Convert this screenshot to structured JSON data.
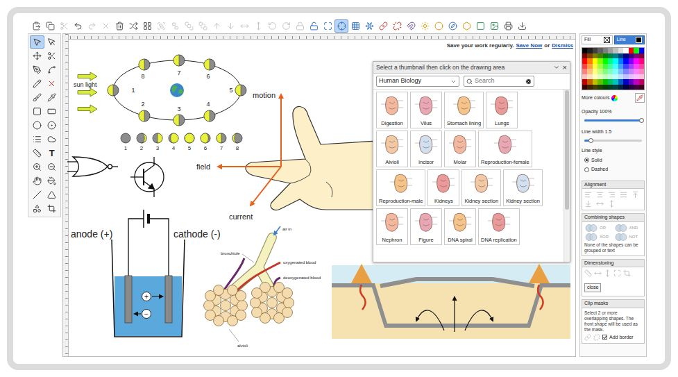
{
  "toolbar": {
    "buttons": [
      {
        "disabled": false,
        "selected": false
      },
      {
        "disabled": false,
        "selected": false
      },
      {
        "disabled": true,
        "selected": false
      },
      {
        "disabled": false,
        "selected": false
      },
      {
        "disabled": true,
        "selected": false
      },
      {
        "disabled": true,
        "selected": false
      },
      {
        "disabled": false,
        "selected": false
      },
      {
        "disabled": false,
        "selected": false
      },
      {
        "disabled": false,
        "selected": false
      },
      {
        "disabled": true,
        "selected": false
      },
      {
        "disabled": true,
        "selected": false
      },
      {
        "disabled": true,
        "selected": false
      },
      {
        "disabled": true,
        "selected": false
      },
      {
        "disabled": true,
        "selected": false
      },
      {
        "disabled": true,
        "selected": false
      },
      {
        "disabled": true,
        "selected": false
      },
      {
        "disabled": true,
        "selected": false
      },
      {
        "disabled": true,
        "selected": false
      },
      {
        "disabled": true,
        "selected": false
      },
      {
        "disabled": true,
        "selected": false
      },
      {
        "disabled": false,
        "selected": false
      },
      {
        "disabled": false,
        "selected": false
      },
      {
        "disabled": false,
        "selected": true
      },
      {
        "disabled": false,
        "selected": false
      },
      {
        "disabled": false,
        "selected": false
      },
      {
        "disabled": false,
        "selected": false
      },
      {
        "disabled": false,
        "selected": false
      },
      {
        "disabled": false,
        "selected": false
      },
      {
        "disabled": false,
        "selected": false
      },
      {
        "disabled": false,
        "selected": false
      },
      {
        "disabled": false,
        "selected": false
      },
      {
        "disabled": false,
        "selected": false
      },
      {
        "disabled": false,
        "selected": false
      },
      {
        "disabled": false,
        "selected": false
      },
      {
        "disabled": false,
        "selected": false
      },
      {
        "disabled": false,
        "selected": false
      }
    ]
  },
  "notice": {
    "text": "Save your work regularly.",
    "save_link": "Save Now",
    "separator": "or",
    "dismiss_link": "Dismiss"
  },
  "tools": [
    {
      "kind": "icon",
      "selected": true
    },
    {
      "kind": "icon",
      "selected": false
    },
    {
      "kind": "icon",
      "selected": false
    },
    {
      "kind": "icon",
      "selected": false
    },
    {
      "kind": "icon",
      "selected": false
    },
    {
      "kind": "icon",
      "selected": false
    },
    {
      "kind": "icon",
      "selected": false
    },
    {
      "kind": "icon",
      "selected": false
    },
    {
      "kind": "icon",
      "selected": false
    },
    {
      "kind": "icon",
      "selected": false
    },
    {
      "kind": "icon",
      "selected": false
    },
    {
      "kind": "icon",
      "selected": false
    },
    {
      "kind": "icon",
      "selected": false
    },
    {
      "kind": "icon",
      "selected": false
    },
    {
      "kind": "icon",
      "selected": false
    },
    {
      "kind": "icon",
      "selected": false
    },
    {
      "kind": "icon",
      "selected": false
    },
    {
      "kind": "glyph",
      "label": "T",
      "selected": false
    },
    {
      "kind": "icon",
      "selected": false
    },
    {
      "kind": "icon",
      "selected": false
    },
    {
      "kind": "icon",
      "selected": false
    },
    {
      "kind": "icon",
      "selected": false
    },
    {
      "kind": "icon",
      "selected": false
    },
    {
      "kind": "icon",
      "selected": false
    },
    {
      "kind": "icon",
      "selected": false
    },
    {
      "kind": "icon",
      "selected": false
    }
  ],
  "canvas": {
    "sunlight_label": "sun light",
    "orbit_moons": [
      {
        "label": "1"
      },
      {
        "label": "2"
      },
      {
        "label": "3"
      },
      {
        "label": "4"
      },
      {
        "label": "5"
      },
      {
        "label": "6"
      },
      {
        "label": "7"
      },
      {
        "label": "8"
      }
    ],
    "phases": [
      {
        "label": "1",
        "level": 0,
        "side": "right"
      },
      {
        "label": "2",
        "level": 0.2,
        "side": "right"
      },
      {
        "label": "3",
        "level": 0.5,
        "side": "right"
      },
      {
        "label": "4",
        "level": 0.8,
        "side": "right"
      },
      {
        "label": "5",
        "level": 1,
        "side": "right"
      },
      {
        "label": "6",
        "level": 0.8,
        "side": "left"
      },
      {
        "label": "7",
        "level": 0.5,
        "side": "left"
      },
      {
        "label": "8",
        "level": 0.2,
        "side": "left"
      }
    ],
    "hand_rule": {
      "motion": "motion",
      "field": "field",
      "current": "current"
    },
    "electrolysis": {
      "anode": "anode (+)",
      "cathode": "cathode (-)",
      "positive_ion": "+",
      "negative_ion": "−"
    },
    "lungs": {
      "air_in": "air in",
      "bronchiole": "bronchiole",
      "oxygenated": "oxygenated blood",
      "deoxygenated": "deoxygenated blood",
      "alveoli": "alvioli"
    }
  },
  "thumbnail_panel": {
    "title": "Select a thumbnail then click on the drawing area",
    "close": "×",
    "category": "Human Biology",
    "search_placeholder": "Search",
    "rows": [
      [
        {
          "label": "Digestion"
        },
        {
          "label": "Vilus"
        },
        {
          "label": "Stomach lining"
        },
        {
          "label": "Lungs"
        }
      ],
      [
        {
          "label": "Alvioli"
        },
        {
          "label": "Incisor"
        },
        {
          "label": "Molar"
        },
        {
          "label": "Reproduction-female"
        }
      ],
      [
        {
          "label": "Reproduction-male"
        },
        {
          "label": "Kidneys"
        },
        {
          "label": "Kidney section"
        },
        {
          "label": "Kidney section"
        }
      ],
      [
        {
          "label": "Nephron"
        },
        {
          "label": "Figure"
        },
        {
          "label": "DNA spiral"
        },
        {
          "label": "DNA replication"
        }
      ]
    ]
  },
  "right_panel": {
    "tabs": [
      {
        "label": "Fill",
        "selected": false,
        "kind": "none"
      },
      {
        "label": "Line",
        "selected": true,
        "kind": "color",
        "color": "#000000"
      }
    ],
    "palette": [
      "#000000",
      "#1f1f1f",
      "#3f3f3f",
      "#5f5f5f",
      "#7f7f7f",
      "#9f9f9f",
      "#bfbfbf",
      "#dfdfdf",
      "#ffffff",
      "#ff0000",
      "#00ff00",
      "#0000ff",
      "#800000",
      "#804000",
      "#808000",
      "#408000",
      "#008000",
      "#008040",
      "#008080",
      "#004080",
      "#000080",
      "#400080",
      "#800080",
      "#800040",
      "#ff0000",
      "#ff8000",
      "#ffff00",
      "#80ff00",
      "#00ff00",
      "#00ff80",
      "#00ffff",
      "#0080ff",
      "#0000ff",
      "#8000ff",
      "#ff00ff",
      "#ff0080",
      "#ff4040",
      "#ffa040",
      "#ffff40",
      "#a0ff40",
      "#40ff40",
      "#40ffa0",
      "#40ffff",
      "#40a0ff",
      "#4040ff",
      "#a040ff",
      "#ff40ff",
      "#ff40a0",
      "#ff8080",
      "#ffc080",
      "#ffff80",
      "#c0ff80",
      "#80ff80",
      "#80ffc0",
      "#80ffff",
      "#80c0ff",
      "#8080ff",
      "#c080ff",
      "#ff80ff",
      "#ff80c0",
      "#ffc0c0",
      "#ffe0c0",
      "#ffffc0",
      "#e0ffc0",
      "#c0ffc0",
      "#c0ffe0",
      "#c0ffff",
      "#c0e0ff",
      "#c0c0ff",
      "#e0c0ff",
      "#ffc0ff",
      "#ffc0e0",
      "#c00000",
      "#c06000",
      "#c0c000",
      "#60c000",
      "#00c000",
      "#00c060",
      "#00c0c0",
      "#0060c0",
      "#0000c0",
      "#6000c0",
      "#c000c0",
      "#c00060",
      "#400000",
      "#402000",
      "#404000",
      "#204000",
      "#004000",
      "#004020",
      "#004040",
      "#002040",
      "#000040",
      "#200040",
      "#400040",
      "#400020"
    ],
    "more_colours": "More colours",
    "opacity": {
      "label": "Opacity 100%",
      "level": 1
    },
    "line_width": {
      "label": "Line width 1.5",
      "level": 0.12
    },
    "line_style": {
      "label": "Line style",
      "options": [
        {
          "label": "Solid",
          "selected": true
        },
        {
          "label": "Dashed",
          "selected": false
        }
      ]
    },
    "alignment": {
      "title": "Alignment",
      "disabled": true
    },
    "combining": {
      "title": "Combining shapes",
      "buttons": [
        {
          "label": "OR",
          "disabled": true
        },
        {
          "label": "AND",
          "disabled": true
        },
        {
          "label": "XOR",
          "disabled": true
        },
        {
          "label": "NOT",
          "disabled": true
        }
      ],
      "note": "None of the shapes can be grouped or text"
    },
    "dimensioning": {
      "title": "Dimensioning",
      "disabled": true,
      "close": "close"
    },
    "clip_masks": {
      "title": "Clip masks",
      "note": "Select 2 or more overlapping shapes. The front shape will be used as the mask.",
      "disabled": true,
      "add_border": {
        "label": "Add border",
        "checked": true
      }
    }
  }
}
